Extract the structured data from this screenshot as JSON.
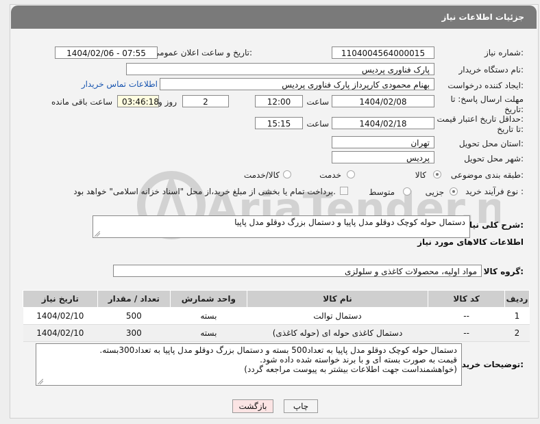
{
  "header": {
    "title": "جزئیات اطلاعات نیاز"
  },
  "fields": {
    "need_number_label": "شماره نیاز:",
    "need_number": "1104004564000015",
    "announce_label": "تاریخ و ساعت اعلان عمومی:",
    "announce_value": "1404/02/06 - 07:55",
    "buyer_org_label": "نام دستگاه خریدار:",
    "buyer_org": "پارک فناوری پردیس",
    "requester_label": "ایجاد کننده درخواست:",
    "requester": "بهنام محمودی کارپرداز پارک فناوری پردیس",
    "contact_link": "اطلاعات تماس خریدار",
    "deadline_label_1": "مهلت ارسال پاسخ: تا",
    "deadline_label_2": "تاریخ:",
    "deadline_date": "1404/02/08",
    "time_label": "ساعت",
    "deadline_time": "12:00",
    "days_value": "2",
    "days_label": "روز و",
    "remaining_value": "03:46:18",
    "remaining_label": "ساعت باقی مانده",
    "validity_label_1": "حداقل تاریخ اعتبار قیمت:",
    "validity_label_2": "تا تاریخ:",
    "validity_date": "1404/02/18",
    "validity_time_label": "ساعت",
    "validity_time": "15:15",
    "province_label": "استان محل تحویل:",
    "province": "تهران",
    "city_label": "شهر محل تحویل:",
    "city": "پردیس",
    "category_label": "طبقه بندی موضوعی:",
    "category_options": [
      "کالا",
      "خدمت",
      "کالا/خدمت"
    ],
    "process_label": "نوع فرآیند خرید :",
    "process_options": [
      "جزیی",
      "متوسط"
    ],
    "payment_note": "پرداخت تمام یا بخشی از مبلغ خرید،از محل \"اسناد خزانه اسلامی\" خواهد بود."
  },
  "description": {
    "label": "شرح کلی نیاز:",
    "text": "دستمال حوله کوچک دوقلو مدل پاپیا و دستمال بزرگ دوقلو مدل پاپیا"
  },
  "goods": {
    "section_title": "اطلاعات کالاهای مورد نیاز",
    "group_label": "گروه کالا:",
    "group_value": "مواد اولیه، محصولات کاغذی و سلولزی",
    "columns": [
      "ردیف",
      "کد کالا",
      "نام کالا",
      "واحد شمارش",
      "تعداد / مقدار",
      "تاریخ نیاز"
    ],
    "rows": [
      [
        "1",
        "--",
        "دستمال توالت",
        "بسته",
        "500",
        "1404/02/10"
      ],
      [
        "2",
        "--",
        "دستمال کاغذی حوله ای (حوله کاغذی)",
        "بسته",
        "300",
        "1404/02/10"
      ]
    ]
  },
  "notes": {
    "label": "توضیحات خریدار:",
    "lines": [
      "دستمال حوله کوچک دوقلو مدل پاپیا به تعداد500 بسته و دستمال بزرگ دوقلو مدل پاپیا به تعداد300بسته.",
      "قیمت به صورت بسته ای و با برند خواسته شده داده شود.",
      "(خواهشمنداست جهت اطلاعات بیشتر به پیوست مراجعه گردد)"
    ]
  },
  "buttons": {
    "print": "چاپ",
    "back": "بازگشت"
  },
  "watermark": {
    "text": "AriaTender.net"
  }
}
